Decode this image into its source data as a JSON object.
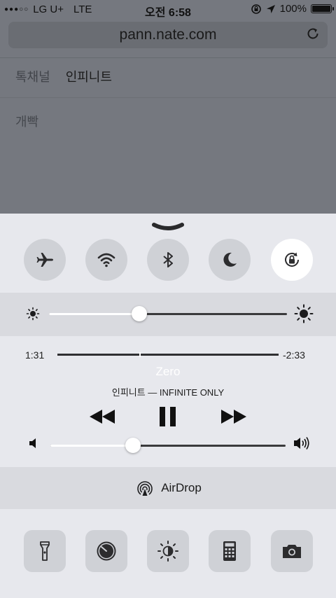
{
  "status_bar": {
    "carrier": "LG U+",
    "network": "LTE",
    "time": "오전 6:58",
    "battery": "100%",
    "signal_dots": "●●●○○",
    "icons": [
      "rotation-lock-icon",
      "location-arrow-icon",
      "battery-icon"
    ]
  },
  "browser": {
    "url": "pann.nate.com",
    "tabs": [
      "톡채널",
      "인피니트"
    ],
    "subtext": "개빡"
  },
  "control_center": {
    "toggles": [
      {
        "name": "airplane-mode",
        "icon": "airplane-icon",
        "active": false
      },
      {
        "name": "wifi",
        "icon": "wifi-icon",
        "active": false
      },
      {
        "name": "bluetooth",
        "icon": "bluetooth-icon",
        "active": false
      },
      {
        "name": "do-not-disturb",
        "icon": "moon-icon",
        "active": false
      },
      {
        "name": "rotation-lock",
        "icon": "rotation-lock-icon",
        "active": true
      }
    ],
    "brightness": {
      "level": 0.38
    },
    "music": {
      "elapsed": "1:31",
      "remaining": "-2:33",
      "progress": 0.37,
      "title": "Zero",
      "artist_album": "인피니트 — INFINITE ONLY"
    },
    "volume": {
      "level": 0.35
    },
    "airdrop": {
      "label": "AirDrop"
    },
    "shortcuts": [
      "flashlight-icon",
      "timer-icon",
      "night-shift-icon",
      "calculator-icon",
      "camera-icon"
    ]
  }
}
